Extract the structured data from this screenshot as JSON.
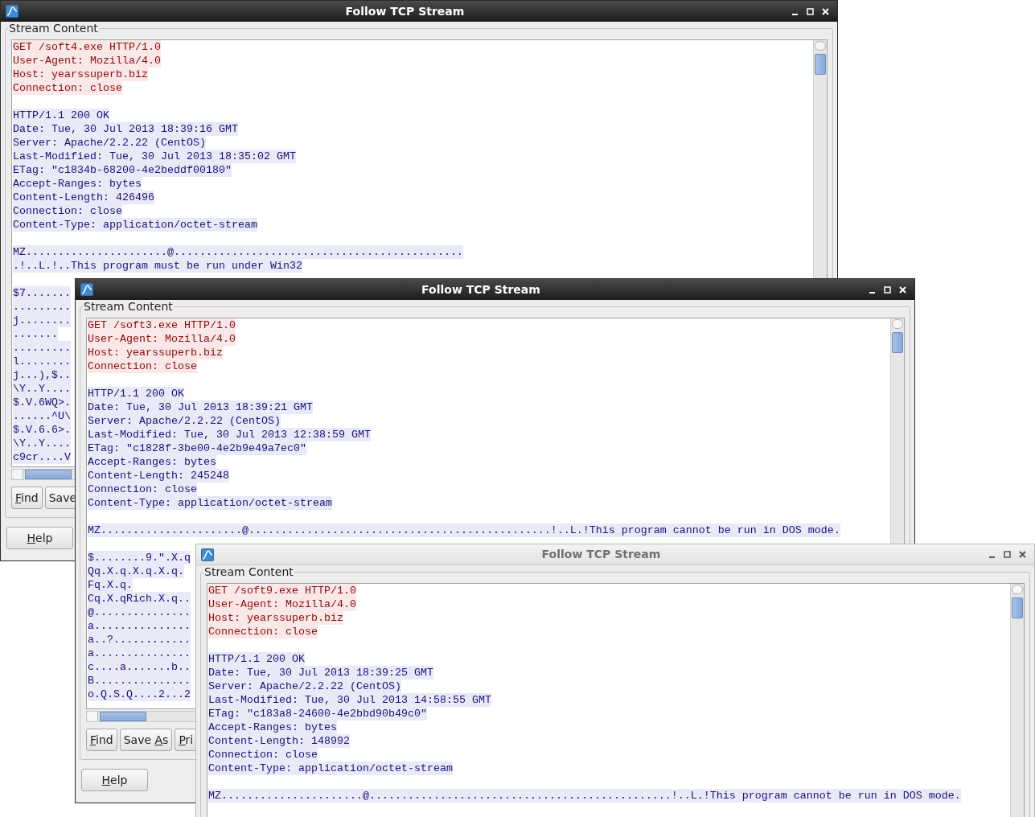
{
  "windows": [
    {
      "title": "Follow TCP Stream",
      "active": true,
      "group_label": "Stream Content",
      "blocks": [
        {
          "kind": "client",
          "lines": [
            "GET /soft4.exe HTTP/1.0",
            "User-Agent: Mozilla/4.0",
            "Host: yearssuperb.biz",
            "Connection: close"
          ]
        },
        {
          "kind": "server",
          "lines": [
            "HTTP/1.1 200 OK",
            "Date: Tue, 30 Jul 2013 18:39:16 GMT",
            "Server: Apache/2.2.22 (CentOS)",
            "Last-Modified: Tue, 30 Jul 2013 18:35:02 GMT",
            "ETag: \"c1834b-68200-4e2beddf00180\"",
            "Accept-Ranges: bytes",
            "Content-Length: 426496",
            "Connection: close",
            "Content-Type: application/octet-stream"
          ]
        },
        {
          "kind": "server",
          "lines": [
            "MZ......................@.............................................",
            ".!..L.!..This program must be run under Win32"
          ]
        },
        {
          "kind": "server",
          "lines": [
            "$7.......",
            ".........",
            "j........",
            ".......",
            ".........",
            "l........",
            "j...),$..",
            "\\Y..Y....",
            "$.V.6WQ>.",
            "......^U\\",
            "$.V.6.6>.",
            "\\Y..Y....",
            "c9cr....V"
          ]
        }
      ],
      "buttons": [
        {
          "key": "F",
          "rest": "ind"
        },
        {
          "lead": "Save"
        }
      ],
      "help_button": {
        "key": "H",
        "rest": "elp"
      }
    },
    {
      "title": "Follow TCP Stream",
      "active": true,
      "group_label": "Stream Content",
      "blocks": [
        {
          "kind": "client",
          "lines": [
            "GET /soft3.exe HTTP/1.0",
            "User-Agent: Mozilla/4.0",
            "Host: yearssuperb.biz",
            "Connection: close"
          ]
        },
        {
          "kind": "server",
          "lines": [
            "HTTP/1.1 200 OK",
            "Date: Tue, 30 Jul 2013 18:39:21 GMT",
            "Server: Apache/2.2.22 (CentOS)",
            "Last-Modified: Tue, 30 Jul 2013 12:38:59 GMT",
            "ETag: \"c1828f-3be00-4e2b9e49a7ec0\"",
            "Accept-Ranges: bytes",
            "Content-Length: 245248",
            "Connection: close",
            "Content-Type: application/octet-stream"
          ]
        },
        {
          "kind": "server",
          "lines": [
            "MZ......................@...............................................!..L.!This program cannot be run in DOS mode."
          ]
        },
        {
          "kind": "server",
          "lines": [
            "$........9.\".X.q",
            "Qq.X.q.X.q.X.q.",
            "Fq.X.q.",
            "Cq.X.qRich.X.q..",
            "@...............",
            "a...............",
            "a..?............",
            "a...............",
            "c....a.......b..",
            "B...............",
            "o.Q.S.Q....2...2"
          ]
        }
      ],
      "buttons": [
        {
          "key": "F",
          "rest": "ind"
        },
        {
          "lead": "Save ",
          "key": "A",
          "rest": "s"
        },
        {
          "key": "P",
          "rest": "ri"
        }
      ],
      "help_button": {
        "key": "H",
        "rest": "elp"
      }
    },
    {
      "title": "Follow TCP Stream",
      "active": false,
      "group_label": "Stream Content",
      "blocks": [
        {
          "kind": "client",
          "lines": [
            "GET /soft9.exe HTTP/1.0",
            "User-Agent: Mozilla/4.0",
            "Host: yearssuperb.biz",
            "Connection: close"
          ]
        },
        {
          "kind": "server",
          "lines": [
            "HTTP/1.1 200 OK",
            "Date: Tue, 30 Jul 2013 18:39:25 GMT",
            "Server: Apache/2.2.22 (CentOS)",
            "Last-Modified: Tue, 30 Jul 2013 14:58:55 GMT",
            "ETag: \"c183a8-24600-4e2bbd90b49c0\"",
            "Accept-Ranges: bytes",
            "Content-Length: 148992",
            "Connection: close",
            "Content-Type: application/octet-stream"
          ]
        },
        {
          "kind": "server",
          "lines": [
            "MZ......................@...............................................!..L.!This program cannot be run in DOS mode."
          ]
        }
      ]
    }
  ]
}
